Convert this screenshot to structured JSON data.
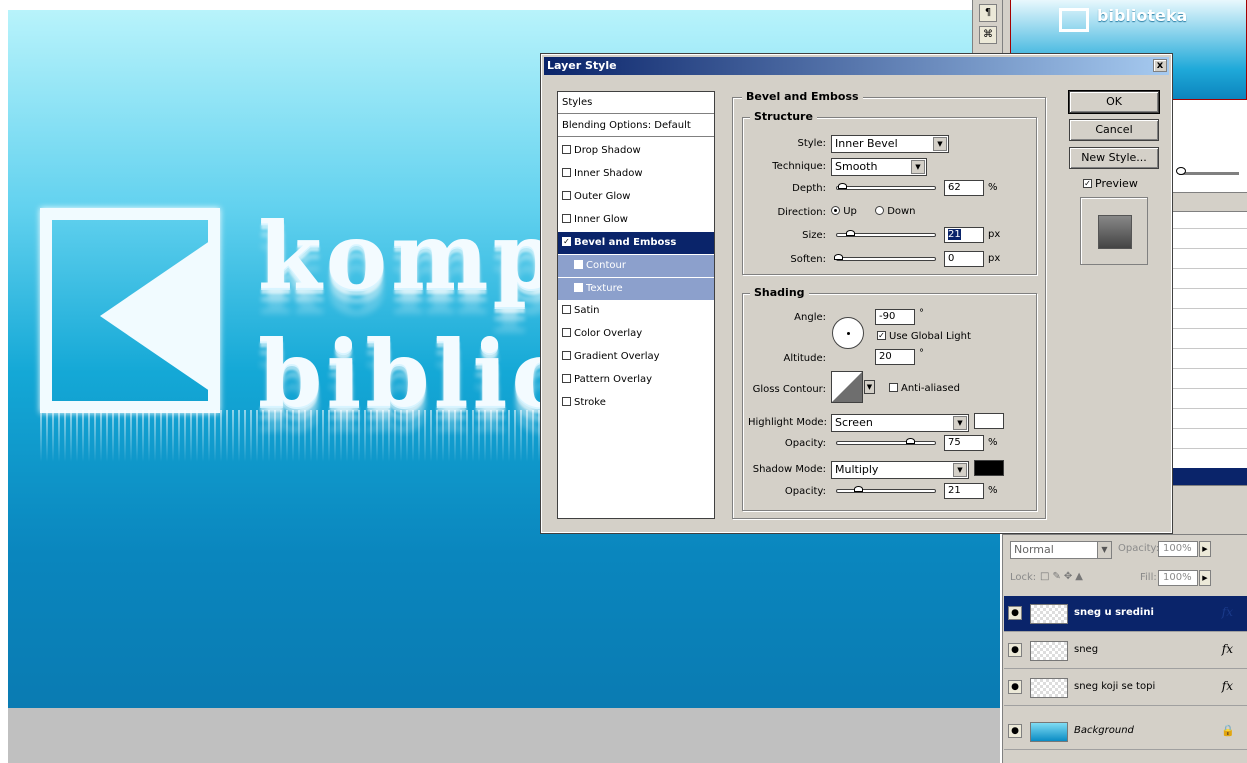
{
  "canvas": {
    "line1": "kompjuter",
    "line2": "biblioteka"
  },
  "navigator": {
    "title_text": "biblioteka"
  },
  "layers": {
    "blend_mode": "Normal",
    "opacity_label": "Opacity:",
    "opacity_value": "100%",
    "lock_label": "Lock:",
    "fill_label": "Fill:",
    "fill_value": "100%",
    "items": [
      {
        "name": "sneg u sredini",
        "selected": true,
        "fx": true
      },
      {
        "name": "sneg",
        "selected": false,
        "fx": true
      },
      {
        "name": "sneg koji se topi",
        "selected": false,
        "fx": true
      },
      {
        "name": "Background",
        "selected": false,
        "fx": false,
        "locked": true
      }
    ],
    "fx_label": "fx"
  },
  "dialog": {
    "title": "Layer Style",
    "close_glyph": "x",
    "styles_list": {
      "header": "Styles",
      "blending": "Blending Options: Default",
      "items": [
        {
          "label": "Drop Shadow",
          "checked": false
        },
        {
          "label": "Inner Shadow",
          "checked": false
        },
        {
          "label": "Outer Glow",
          "checked": false
        },
        {
          "label": "Inner Glow",
          "checked": false
        },
        {
          "label": "Bevel and Emboss",
          "checked": true,
          "selected": true
        },
        {
          "label": "Contour",
          "checked": false,
          "sub": true
        },
        {
          "label": "Texture",
          "checked": false,
          "sub": true
        },
        {
          "label": "Satin",
          "checked": false
        },
        {
          "label": "Color Overlay",
          "checked": false
        },
        {
          "label": "Gradient Overlay",
          "checked": false
        },
        {
          "label": "Pattern Overlay",
          "checked": false
        },
        {
          "label": "Stroke",
          "checked": false
        }
      ]
    },
    "bevel": {
      "group_title": "Bevel and Emboss",
      "structure": {
        "title": "Structure",
        "style_label": "Style:",
        "style_value": "Inner Bevel",
        "technique_label": "Technique:",
        "technique_value": "Smooth",
        "depth_label": "Depth:",
        "depth_value": "62",
        "depth_unit": "%",
        "direction_label": "Direction:",
        "direction_up": "Up",
        "direction_down": "Down",
        "size_label": "Size:",
        "size_value": "21",
        "size_unit": "px",
        "soften_label": "Soften:",
        "soften_value": "0",
        "soften_unit": "px"
      },
      "shading": {
        "title": "Shading",
        "angle_label": "Angle:",
        "angle_value": "-90",
        "degree": "°",
        "global_light_label": "Use Global Light",
        "altitude_label": "Altitude:",
        "altitude_value": "20",
        "gloss_label": "Gloss Contour:",
        "anti_aliased_label": "Anti-aliased",
        "highlight_label": "Highlight Mode:",
        "highlight_value": "Screen",
        "highlight_color": "#ffffff",
        "highlight_opacity_label": "Opacity:",
        "highlight_opacity_value": "75",
        "shadow_label": "Shadow Mode:",
        "shadow_value": "Multiply",
        "shadow_color": "#000000",
        "shadow_opacity_label": "Opacity:",
        "shadow_opacity_value": "21",
        "percent": "%"
      }
    },
    "buttons": {
      "ok": "OK",
      "cancel": "Cancel",
      "new_style": "New Style...",
      "preview": "Preview"
    }
  }
}
